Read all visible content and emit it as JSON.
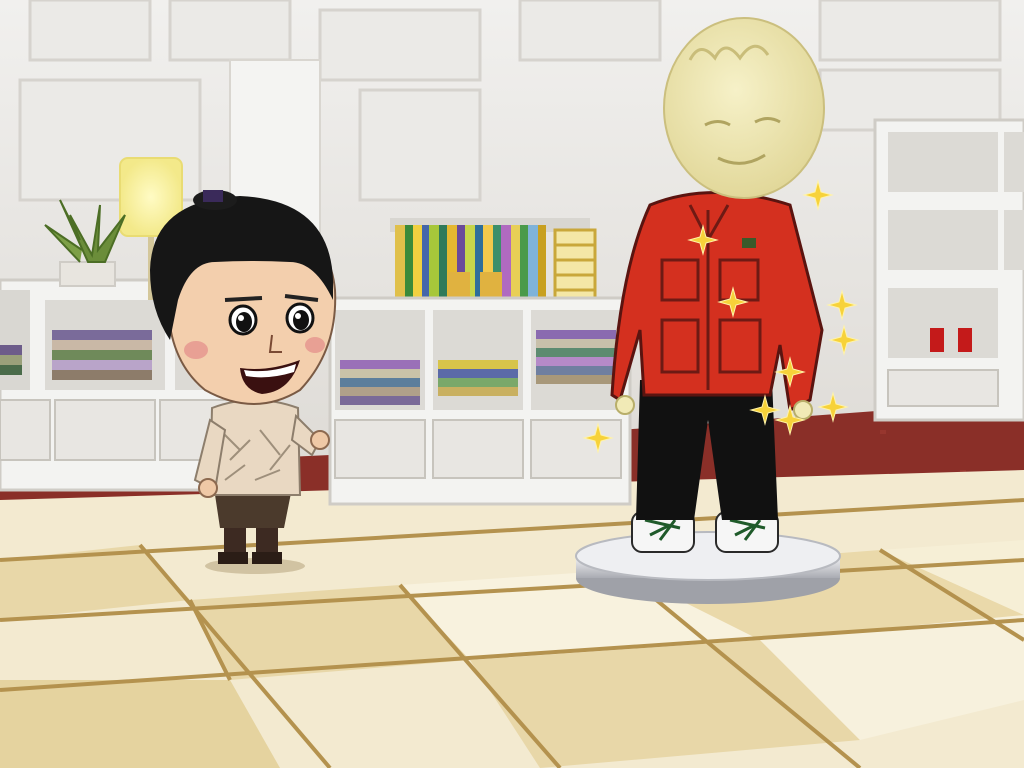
{
  "scene": {
    "kind": "clothing-shop-interior",
    "view": "3d-game-scene"
  },
  "characters": [
    {
      "role": "shopkeeper",
      "icon": "mii-shopkeeper-character"
    },
    {
      "role": "mannequin",
      "icon": "mannequin-character",
      "outfit": "red-jacket-black-pants-white-sneakers",
      "pedestal": "round-silver-pedestal"
    }
  ],
  "props": [
    "floor-lamp-icon",
    "potted-plant-icon",
    "book-shelf-icon",
    "folded-clothes-stack-icon",
    "red-shoes-icon",
    "sparkle-icon"
  ],
  "colors": {
    "wall": "#ecebe8",
    "shelf": "#f3f3f1",
    "carpet": "#8a2f28",
    "floor_light": "#f6efd6",
    "floor_dark": "#eadcb2",
    "floor_line": "#b4924e",
    "jacket": "#d4301f",
    "mannequin_head": "#f1eab6",
    "sparkle": "#f7d23a"
  }
}
